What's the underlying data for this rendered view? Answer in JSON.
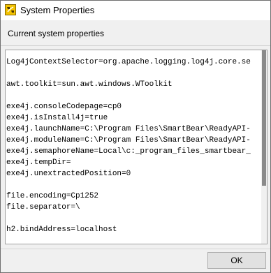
{
  "window": {
    "title": "System Properties",
    "icon": "app-logo-icon"
  },
  "header": {
    "label": "Current system properties"
  },
  "properties": {
    "lines": [
      "Log4jContextSelector=org.apache.logging.log4j.core.se",
      "",
      "awt.toolkit=sun.awt.windows.WToolkit",
      "",
      "exe4j.consoleCodepage=cp0",
      "exe4j.isInstall4j=true",
      "exe4j.launchName=C:\\Program Files\\SmartBear\\ReadyAPI-",
      "exe4j.moduleName=C:\\Program Files\\SmartBear\\ReadyAPI-",
      "exe4j.semaphoreName=Local\\c:_program_files_smartbear_",
      "exe4j.tempDir=",
      "exe4j.unextractedPosition=0",
      "",
      "file.encoding=Cp1252",
      "file.separator=\\",
      "",
      "h2.bindAddress=localhost"
    ]
  },
  "footer": {
    "ok_label": "OK"
  },
  "colors": {
    "icon_fill": "#f2c200",
    "scrollbar_thumb": "#8a8a8a",
    "button_face": "#e1e1e1"
  }
}
